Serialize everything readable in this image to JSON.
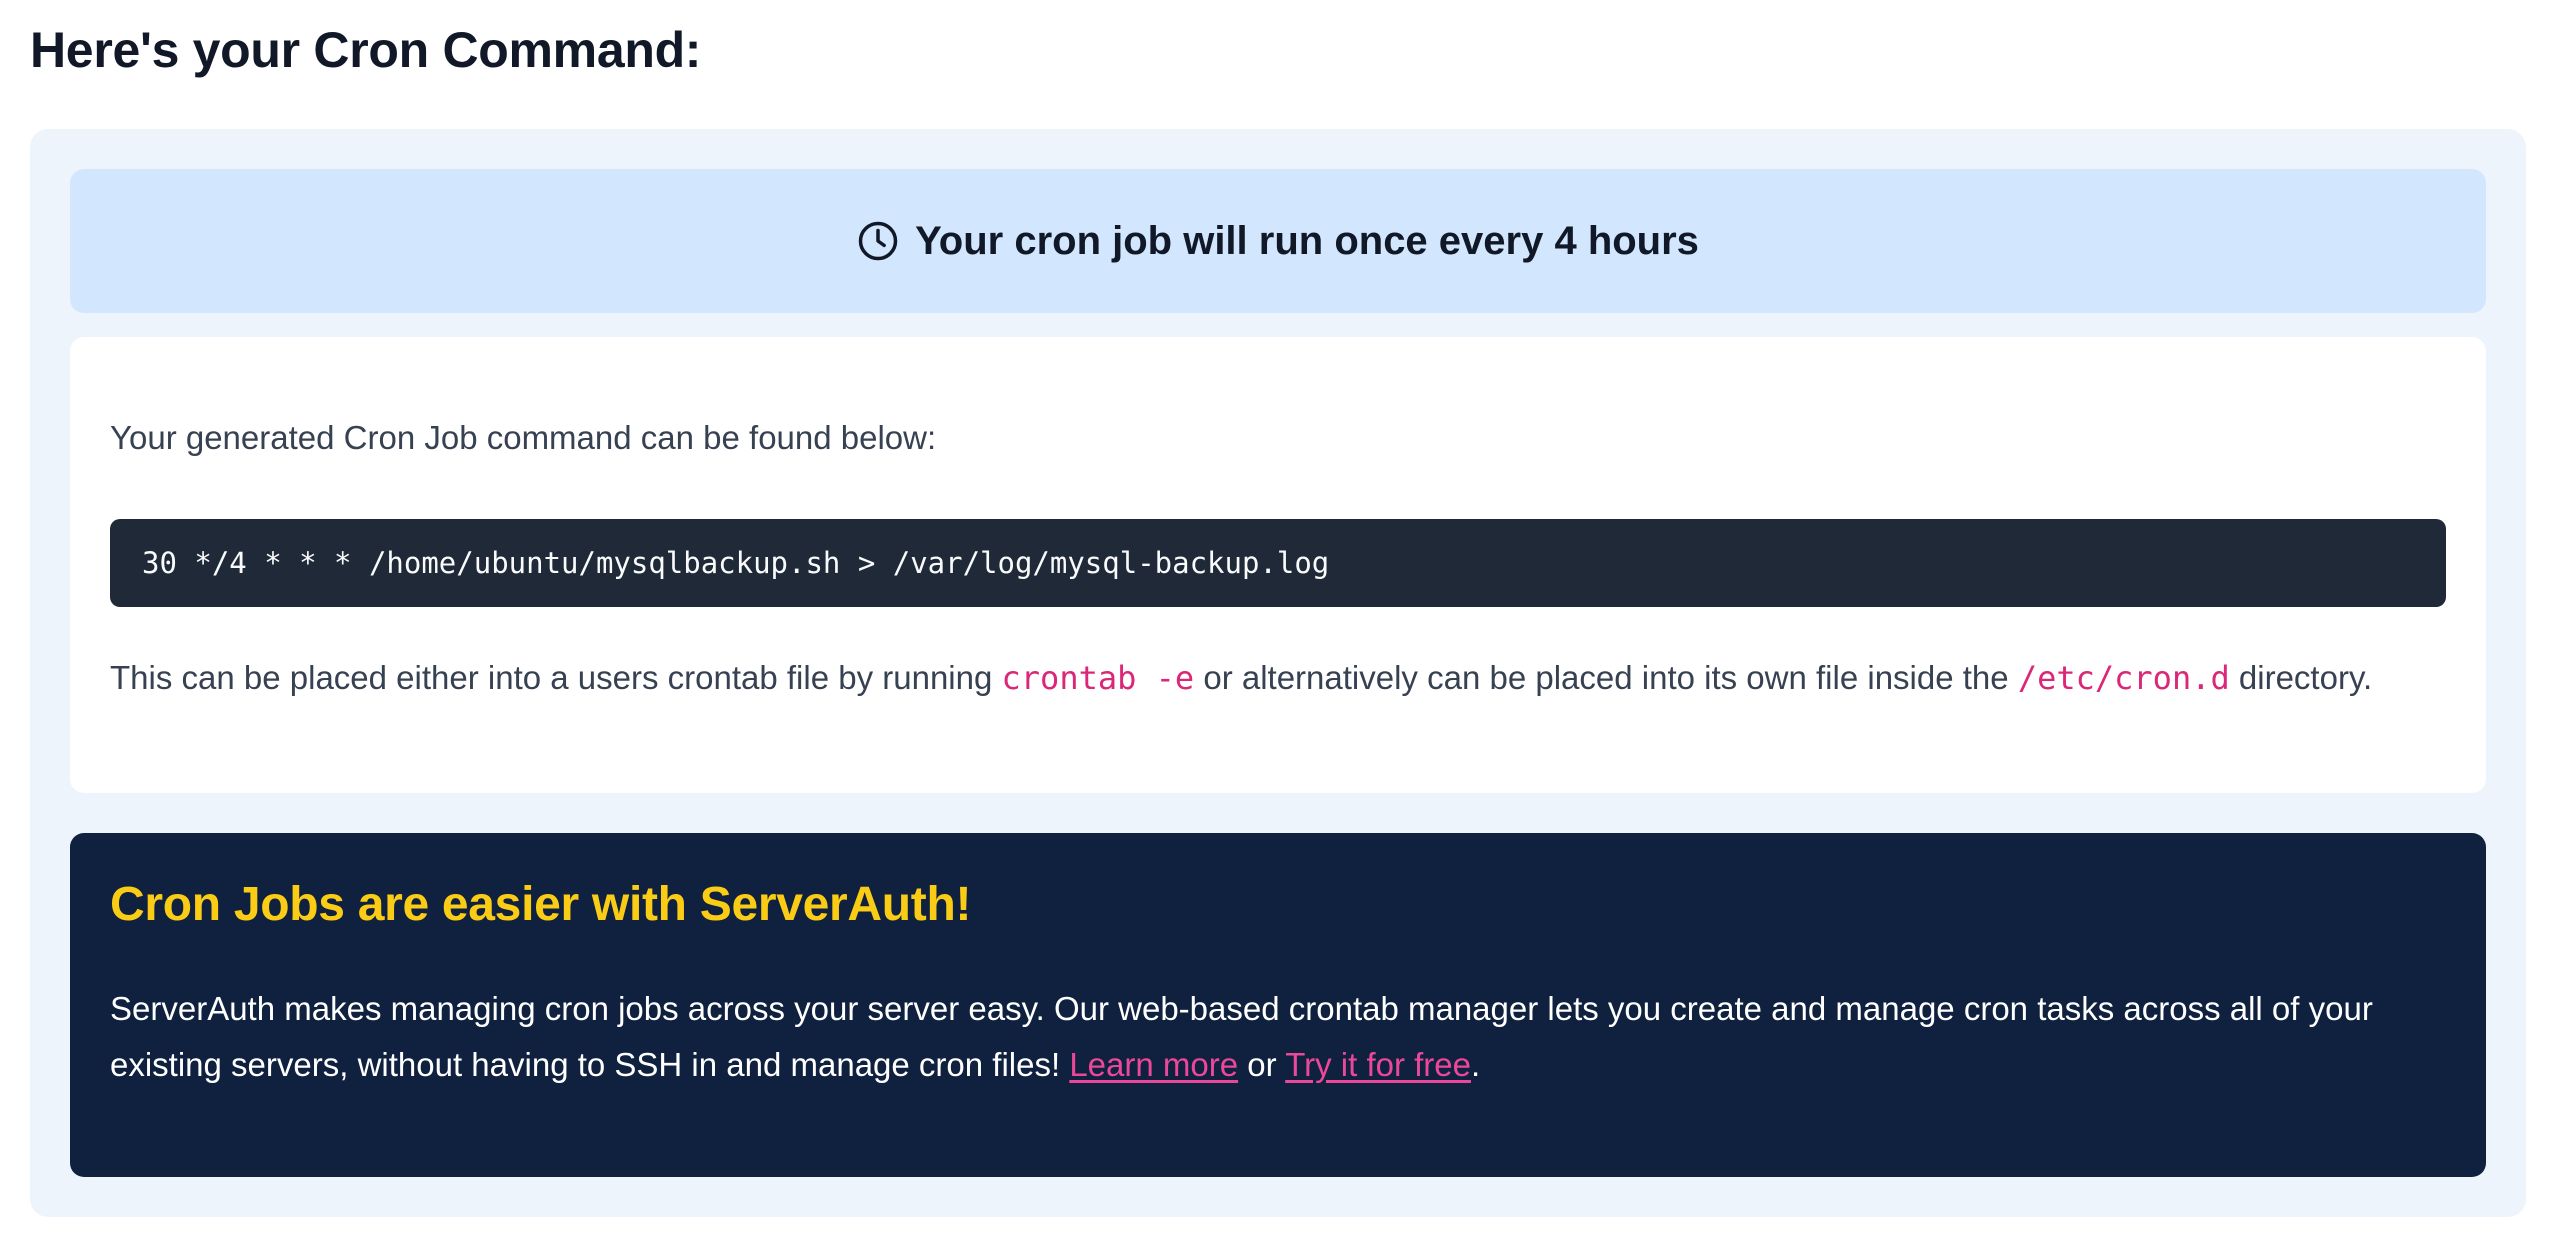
{
  "page": {
    "title": "Here's your Cron Command:"
  },
  "schedule": {
    "icon": "clock-icon",
    "text": "Your cron job will run once every 4 hours"
  },
  "command": {
    "intro": "Your generated Cron Job command can be found below:",
    "code": "30 */4 * * * /home/ubuntu/mysqlbackup.sh > /var/log/mysql-backup.log",
    "placement_prefix": "This can be placed either into a users crontab file by running ",
    "crontab_cmd": "crontab -e",
    "placement_middle": " or alternatively can be placed into its own file inside the ",
    "cron_dir": "/etc/cron.d",
    "placement_suffix": " directory."
  },
  "promo": {
    "title": "Cron Jobs are easier with ServerAuth!",
    "body": "ServerAuth makes managing cron jobs across your server easy. Our web-based crontab manager lets you create and manage cron tasks across all of your existing servers, without having to SSH in and manage cron files! ",
    "learn_more_label": "Learn more",
    "or_text": " or ",
    "try_free_label": "Try it for free",
    "end_text": "."
  },
  "colors": {
    "panel_bg": "#eef4fc",
    "banner_bg": "#d2e6fd",
    "code_bg": "#1f2937",
    "promo_bg": "#0f213f",
    "promo_title": "#facc15",
    "link": "#ec4899",
    "inline_code": "#db2777"
  }
}
